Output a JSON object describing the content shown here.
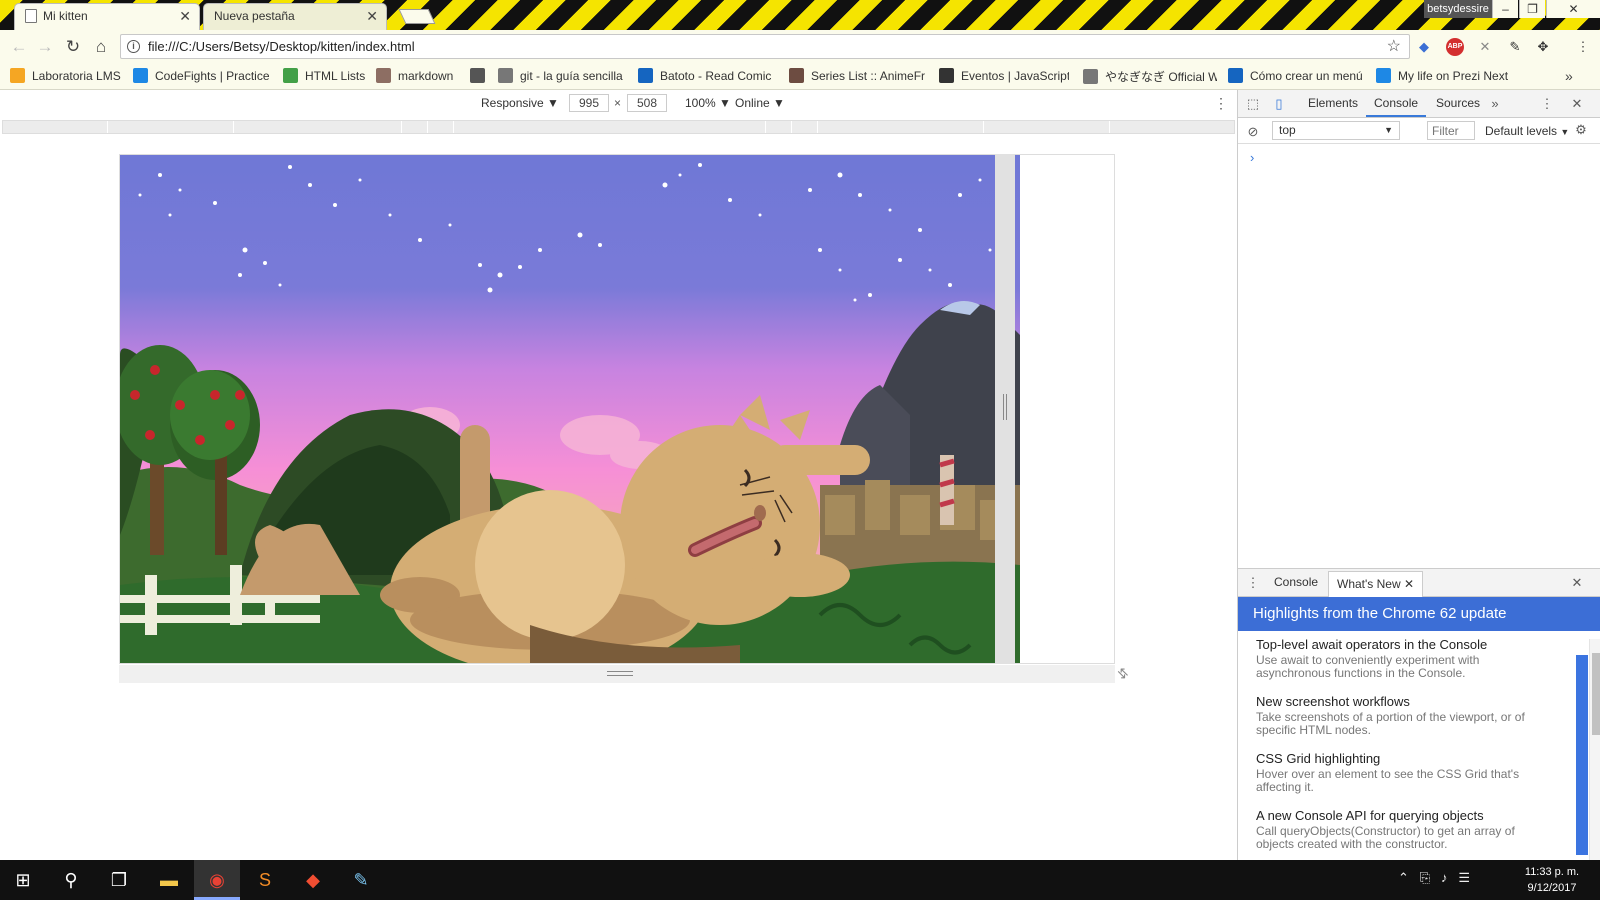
{
  "browser": {
    "tabs": [
      {
        "title": "Mi kitten",
        "active": true
      },
      {
        "title": "Nueva pestaña",
        "active": false
      }
    ],
    "user": "betsydessire",
    "window_controls": [
      "–",
      "❐",
      "✕"
    ],
    "url": "file:///C:/Users/Betsy/Desktop/kitten/index.html"
  },
  "bookmarks": [
    {
      "label": "Laboratoria LMS",
      "color": "#f5a623"
    },
    {
      "label": "CodeFights | Practice",
      "color": "#1e88e5"
    },
    {
      "label": "HTML Lists",
      "color": "#43a047"
    },
    {
      "label": "markdown",
      "color": "#8d6e63"
    },
    {
      "label": "",
      "color": "#555555"
    },
    {
      "label": "git - la guía sencilla",
      "color": "#777777"
    },
    {
      "label": "Batoto - Read Comic",
      "color": "#1565c0"
    },
    {
      "label": "Series List :: AnimeFr",
      "color": "#6d4c41"
    },
    {
      "label": "Eventos | JavaScript",
      "color": "#333333"
    },
    {
      "label": "やなぎなぎ Official We",
      "color": "#777777"
    },
    {
      "label": "Cómo crear un menú",
      "color": "#1565c0"
    },
    {
      "label": "My life on Prezi Next",
      "color": "#1e88e5"
    }
  ],
  "device_toolbar": {
    "mode": "Responsive",
    "width": "995",
    "times": "×",
    "height": "508",
    "zoom": "100%",
    "network": "Online",
    "caret": "▼"
  },
  "devtools": {
    "tabs": [
      "Elements",
      "Console",
      "Sources"
    ],
    "active_tab": "Console",
    "more": "»",
    "context": "top",
    "filter_placeholder": "Filter",
    "levels": "Default levels",
    "prompt": "›",
    "drawer": {
      "tabs": [
        "Console",
        "What's New"
      ],
      "active_tab": "What's New",
      "banner": "Highlights from the Chrome 62 update",
      "items": [
        {
          "title": "Top-level await operators in the Console",
          "desc": "Use await to conveniently experiment with asynchronous functions in the Console."
        },
        {
          "title": "New screenshot workflows",
          "desc": "Take screenshots of a portion of the viewport, or of specific HTML nodes."
        },
        {
          "title": "CSS Grid highlighting",
          "desc": "Hover over an element to see the CSS Grid that's affecting it."
        },
        {
          "title": "A new Console API for querying objects",
          "desc": "Call queryObjects(Constructor) to get an array of objects created with the constructor."
        }
      ]
    }
  },
  "taskbar": {
    "clock_time": "11:33 p. m.",
    "clock_date": "9/12/2017"
  },
  "colors": {
    "tab_strip": "#f5e400",
    "accent": "#3879d9",
    "banner": "#3c6ed6"
  }
}
